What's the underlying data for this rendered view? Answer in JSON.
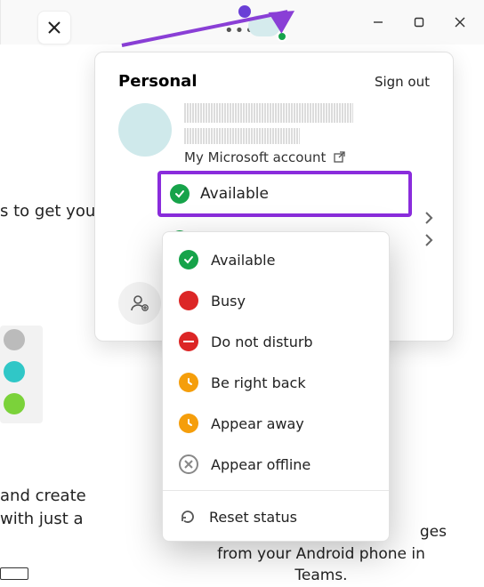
{
  "window": {
    "bg_text_left": "s to get you g",
    "bg_lines": [
      "and create",
      "with just a"
    ],
    "tail_lines": [
      "ges",
      "from your Android phone in",
      "Teams."
    ]
  },
  "panel": {
    "title": "Personal",
    "signout": "Sign out",
    "ms_link": "My Microsoft account",
    "current_status": "Available",
    "second_status": "Available"
  },
  "dropdown": {
    "items": [
      {
        "label": "Available",
        "kind": "avail"
      },
      {
        "label": "Busy",
        "kind": "busy"
      },
      {
        "label": "Do not disturb",
        "kind": "dnd"
      },
      {
        "label": "Be right back",
        "kind": "away"
      },
      {
        "label": "Appear away",
        "kind": "away"
      },
      {
        "label": "Appear offline",
        "kind": "offline"
      }
    ],
    "reset": "Reset status"
  }
}
